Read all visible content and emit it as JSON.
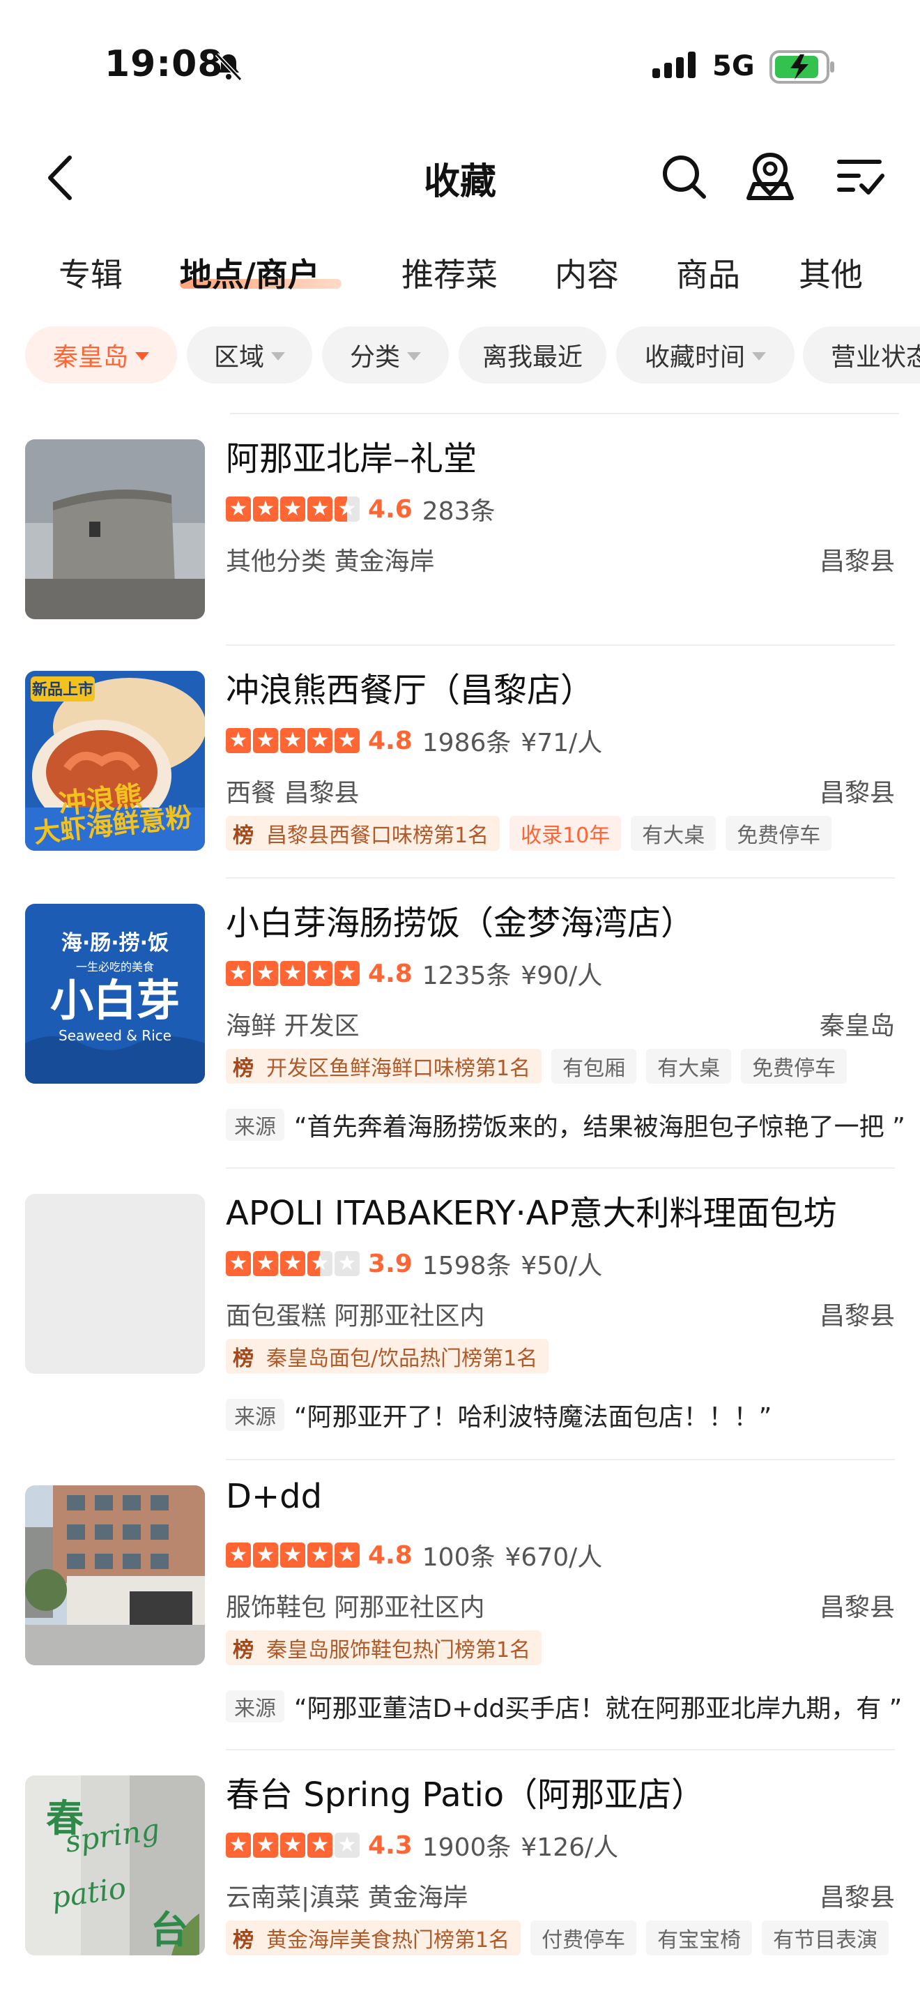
{
  "status": {
    "time": "19:08",
    "network": "5G"
  },
  "nav": {
    "title": "收藏"
  },
  "tabs": [
    {
      "label": "专辑",
      "active": false
    },
    {
      "label": "地点/商户",
      "active": true
    },
    {
      "label": "推荐菜",
      "active": false
    },
    {
      "label": "内容",
      "active": false
    },
    {
      "label": "商品",
      "active": false
    },
    {
      "label": "其他",
      "active": false
    }
  ],
  "filters": [
    {
      "label": "秦皇岛",
      "active": true,
      "dropdown": true
    },
    {
      "label": "区域",
      "active": false,
      "dropdown": true
    },
    {
      "label": "分类",
      "active": false,
      "dropdown": true
    },
    {
      "label": "离我最近",
      "active": false,
      "dropdown": false
    },
    {
      "label": "收藏时间",
      "active": false,
      "dropdown": true
    },
    {
      "label": "营业状态",
      "active": false,
      "dropdown": true
    }
  ],
  "colors": {
    "accent": "#ff6633",
    "rank_bg": "#fff0e6"
  },
  "items": [
    {
      "name": "阿那亚北岸–礼堂",
      "rating": 4.6,
      "score": "4.6",
      "reviews": "283条",
      "price": "",
      "category": "其他分类 黄金海岸",
      "district": "昌黎县",
      "rank": "",
      "tags": [],
      "source_label": "",
      "source": "",
      "thumb": "building-grey"
    },
    {
      "name": "冲浪熊西餐厅（昌黎店）",
      "rating": 5,
      "score": "4.8",
      "reviews": "1986条",
      "price": "¥71/人",
      "category": "西餐 昌黎县",
      "district": "昌黎县",
      "rank": "昌黎县西餐口味榜第1名",
      "tags": [
        {
          "label": "收录10年",
          "style": "orange"
        },
        {
          "label": "有大桌",
          "style": "plain"
        },
        {
          "label": "免费停车",
          "style": "plain"
        }
      ],
      "source_label": "",
      "source": "",
      "thumb": "food-poster",
      "thumb_text": {
        "badge": "新品上市",
        "line1": "冲浪熊",
        "line2": "大虾海鲜意粉"
      }
    },
    {
      "name": "小白芽海肠捞饭（金梦海湾店）",
      "rating": 5,
      "score": "4.8",
      "reviews": "1235条",
      "price": "¥90/人",
      "category": "海鲜 开发区",
      "district": "秦皇岛",
      "rank": "开发区鱼鲜海鲜口味榜第1名",
      "tags": [
        {
          "label": "有包厢",
          "style": "plain"
        },
        {
          "label": "有大桌",
          "style": "plain"
        },
        {
          "label": "免费停车",
          "style": "plain"
        }
      ],
      "source_label": "来源",
      "source": "“首先奔着海肠捞饭来的，结果被海胆包子惊艳了一把 ”",
      "thumb": "blue-logo",
      "thumb_text": {
        "top": "海·肠·捞·饭",
        "sub": "一生必吃的美食",
        "main": "小白芽",
        "en": "Seaweed & Rice"
      }
    },
    {
      "name": "APOLI ITABAKERY·AP意大利料理面包坊",
      "rating": 3.5,
      "score": "3.9",
      "reviews": "1598条",
      "price": "¥50/人",
      "category": "面包蛋糕 阿那亚社区内",
      "district": "昌黎县",
      "rank": "秦皇岛面包/饮品热门榜第1名",
      "tags": [],
      "source_label": "来源",
      "source": "“阿那亚开了！哈利波特魔法面包店！！！”",
      "thumb": "blank"
    },
    {
      "name": "D+dd",
      "rating": 5,
      "score": "4.8",
      "reviews": "100条",
      "price": "¥670/人",
      "category": "服饰鞋包 阿那亚社区内",
      "district": "昌黎县",
      "rank": "秦皇岛服饰鞋包热门榜第1名",
      "tags": [],
      "source_label": "来源",
      "source": "“阿那亚董洁D+dd买手店！就在阿那亚北岸九期，有 ”",
      "thumb": "storefront"
    },
    {
      "name": "春台 Spring Patio（阿那亚店）",
      "rating": 4,
      "score": "4.3",
      "reviews": "1900条",
      "price": "¥126/人",
      "category": "云南菜|滇菜 黄金海岸",
      "district": "昌黎县",
      "rank": "黄金海岸美食热门榜第1名",
      "tags": [
        {
          "label": "付费停车",
          "style": "plain"
        },
        {
          "label": "有宝宝椅",
          "style": "plain"
        },
        {
          "label": "有节目表演",
          "style": "plain"
        }
      ],
      "source_label": "",
      "source": "",
      "thumb": "green-sign",
      "thumb_text": {
        "cn1": "春",
        "cn2": "台",
        "en1": "spring",
        "en2": "patio"
      }
    }
  ]
}
